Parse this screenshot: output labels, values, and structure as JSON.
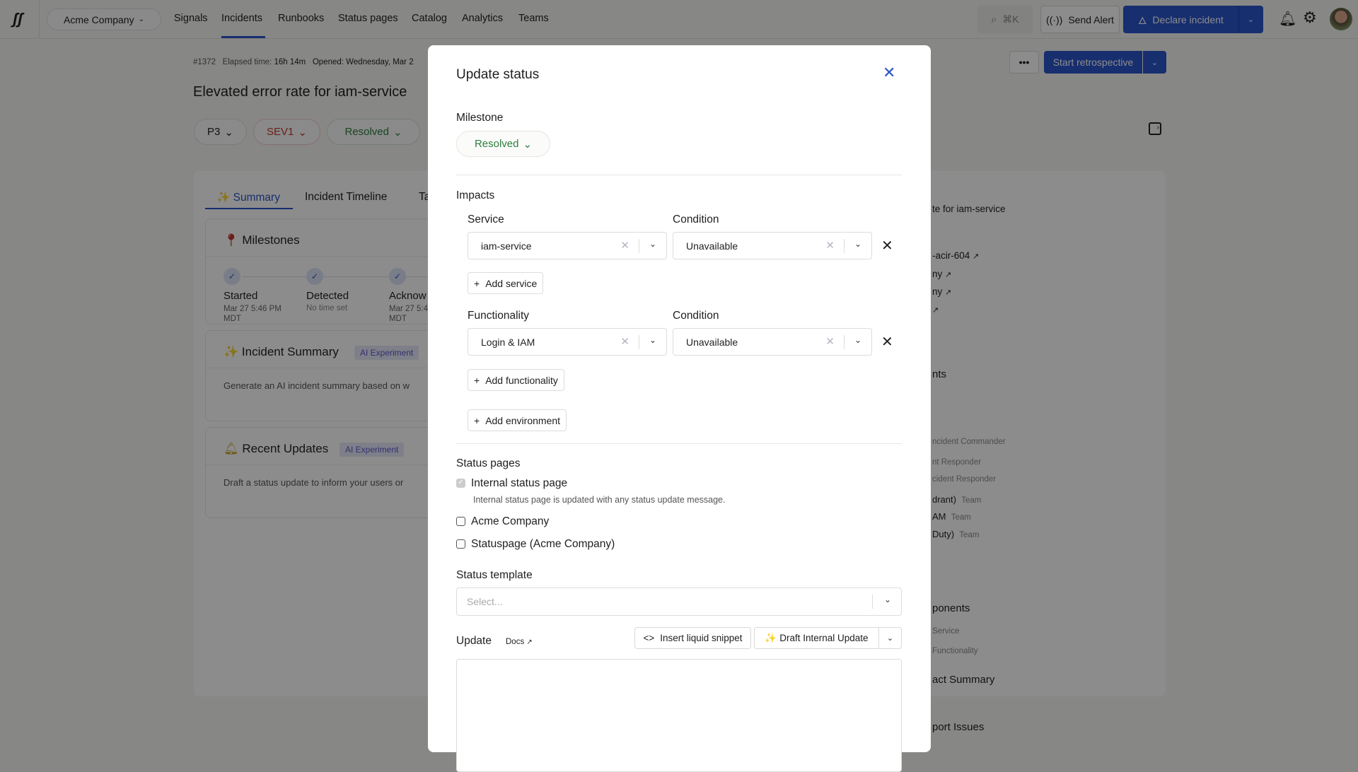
{
  "topbar": {
    "org": "Acme Company",
    "nav": [
      "Signals",
      "Incidents",
      "Runbooks",
      "Status pages",
      "Catalog",
      "Analytics",
      "Teams"
    ],
    "active": "Incidents",
    "search_shortcut": "⌘K",
    "send_alert": "Send Alert",
    "declare": "Declare incident"
  },
  "incident": {
    "number": "#1372",
    "elapsed_label": "Elapsed time:",
    "elapsed": "16h 14m",
    "opened": "Opened: Wednesday, Mar 2",
    "title": "Elevated error rate for iam-service",
    "priority": "P3",
    "severity": "SEV1",
    "milestone": "Resolved",
    "more": "•••",
    "retro": "Start retrospective"
  },
  "tabs": [
    "Summary",
    "Incident Timeline",
    "Ta"
  ],
  "milestones": {
    "title": "Milestones",
    "items": [
      {
        "name": "Started",
        "time": "Mar 27 5:46 PM",
        "tz": "MDT"
      },
      {
        "name": "Detected",
        "time": "No time set",
        "tz": ""
      },
      {
        "name": "Acknow",
        "time": "Mar 27 5:4",
        "tz": "MDT"
      }
    ]
  },
  "incident_summary": {
    "title": "Incident Summary",
    "badge": "AI Experiment",
    "text": "Generate an AI incident summary based on w"
  },
  "recent_updates": {
    "title": "Recent Updates",
    "badge": "AI Experiment",
    "text": "Draft a status update to inform your users or"
  },
  "right": {
    "title_frag": "te for iam-service",
    "links": [
      "-acir-604",
      "ny",
      "ny",
      ""
    ],
    "section1": "nts",
    "roles": [
      "ncident Commander",
      "nt Responder",
      "cident Responder"
    ],
    "teams": [
      {
        "n": "drant)",
        "t": "Team"
      },
      {
        "n": "AM",
        "t": "Team"
      },
      {
        "n": "Duty)",
        "t": "Team"
      }
    ],
    "section2": "ponents",
    "comp": [
      "Service",
      "Functionality"
    ],
    "section3": "act Summary",
    "section4": "port Issues"
  },
  "modal": {
    "title": "Update status",
    "milestone_label": "Milestone",
    "milestone_value": "Resolved",
    "impacts_label": "Impacts",
    "service_label": "Service",
    "condition_label": "Condition",
    "service_value": "iam-service",
    "service_condition": "Unavailable",
    "add_service": "Add service",
    "functionality_label": "Functionality",
    "functionality_value": "Login & IAM",
    "functionality_condition": "Unavailable",
    "add_functionality": "Add functionality",
    "add_environment": "Add environment",
    "status_pages_label": "Status pages",
    "status_pages": [
      {
        "label": "Internal status page",
        "checked": true,
        "disabled": true,
        "desc": "Internal status page is updated with any status update message."
      },
      {
        "label": "Acme Company",
        "checked": false
      },
      {
        "label": "Statuspage (Acme Company)",
        "checked": false
      }
    ],
    "template_label": "Status template",
    "template_placeholder": "Select...",
    "update_label": "Update",
    "docs": "Docs",
    "insert_snippet": "Insert liquid snippet",
    "draft_update": "Draft Internal Update",
    "update_text": ""
  },
  "colors": {
    "accent": "#2a53c9",
    "green": "#2e7d3e",
    "red": "#c0392b"
  }
}
